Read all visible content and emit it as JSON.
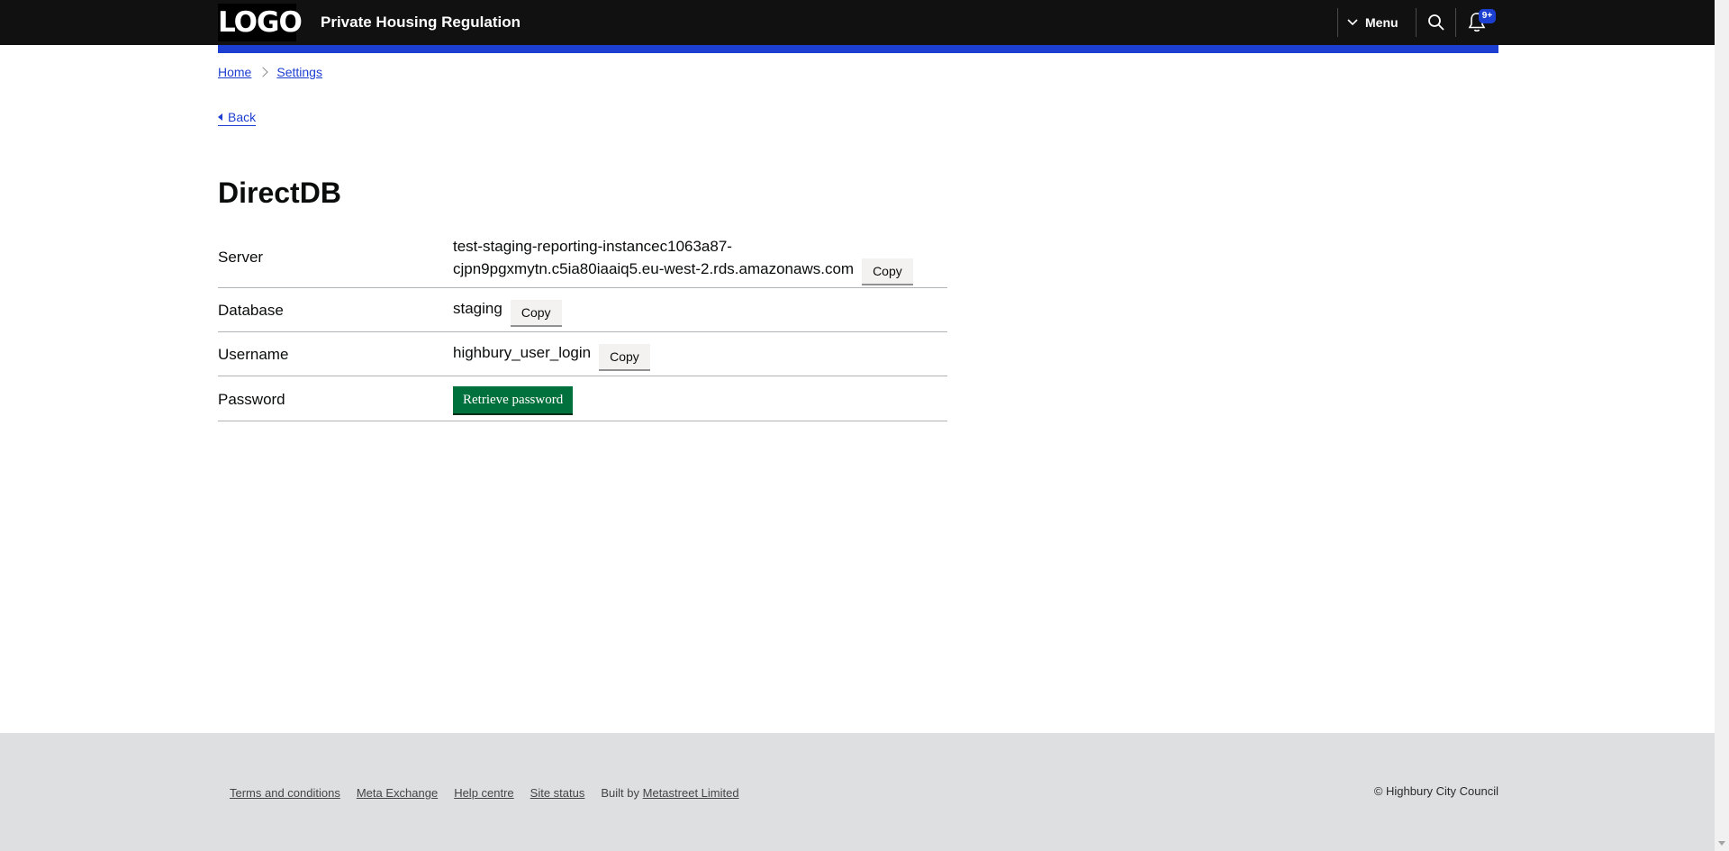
{
  "header": {
    "logo_text": "LOGO",
    "service_name": "Private Housing Regulation",
    "menu_label": "Menu",
    "notification_count": "9+",
    "icons": {
      "menu": "chevron-down-icon",
      "search": "search-icon",
      "notifications": "bell-icon"
    }
  },
  "breadcrumbs": [
    {
      "label": "Home"
    },
    {
      "label": "Settings"
    }
  ],
  "back_link": "Back",
  "page_title": "DirectDB",
  "details": {
    "server": {
      "label": "Server",
      "value_line1": "test-staging-reporting-instancec1063a87-",
      "value_line2": "cjpn9pgxmytn.c5ia80iaaiq5.eu-west-2.rds.amazonaws.com",
      "copy_label": "Copy"
    },
    "database": {
      "label": "Database",
      "value": "staging",
      "copy_label": "Copy"
    },
    "username": {
      "label": "Username",
      "value": "highbury_user_login",
      "copy_label": "Copy"
    },
    "password": {
      "label": "Password",
      "button_label": "Retrieve password"
    }
  },
  "footer": {
    "links": [
      "Terms and conditions",
      "Meta Exchange",
      "Help centre",
      "Site status"
    ],
    "built_by_prefix": "Built by",
    "built_by_link": "Metastreet Limited",
    "copyright": "© Highbury City Council"
  },
  "colors": {
    "header_bg": "#111111",
    "accent_blue": "#1d3fd1",
    "primary_button": "#00703c",
    "footer_bg": "#dedfe1"
  }
}
